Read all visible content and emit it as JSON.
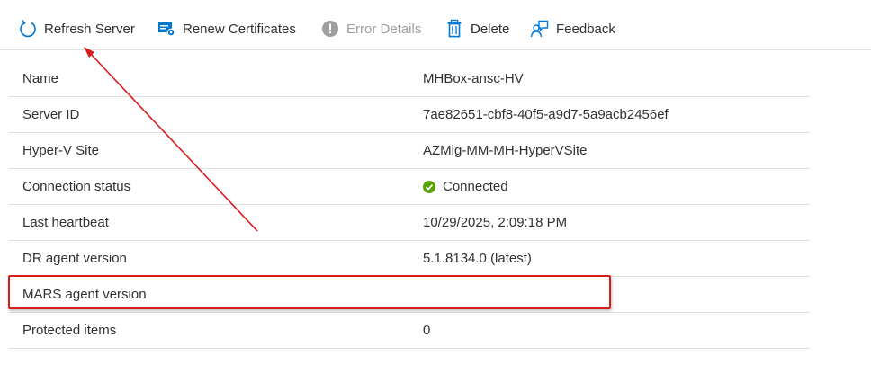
{
  "toolbar": {
    "refresh": {
      "label": "Refresh Server",
      "icon": "refresh-icon"
    },
    "renew": {
      "label": "Renew Certificates",
      "icon": "certificate-icon"
    },
    "error": {
      "label": "Error Details",
      "icon": "info-icon",
      "disabled": true
    },
    "delete": {
      "label": "Delete",
      "icon": "trash-icon"
    },
    "feedback": {
      "label": "Feedback",
      "icon": "feedback-icon"
    }
  },
  "properties": [
    {
      "label": "Name",
      "value": "MHBox-ansc-HV"
    },
    {
      "label": "Server ID",
      "value": "7ae82651-cbf8-40f5-a9d7-5a9acb2456ef"
    },
    {
      "label": "Hyper-V Site",
      "value": "AZMig-MM-MH-HyperVSite"
    },
    {
      "label": "Connection status",
      "value": "Connected",
      "status_icon": "check-circle-icon",
      "status_color": "#57a300"
    },
    {
      "label": "Last heartbeat",
      "value": "10/29/2025, 2:09:18 PM"
    },
    {
      "label": "DR agent version",
      "value": "5.1.8134.0 (latest)"
    },
    {
      "label": "MARS agent version",
      "value": ""
    },
    {
      "label": "Protected items",
      "value": "0"
    }
  ],
  "colors": {
    "accent": "#0078d4",
    "annotation": "#d81b1b",
    "divider": "#e1dfdd",
    "disabled": "#a19f9d"
  }
}
